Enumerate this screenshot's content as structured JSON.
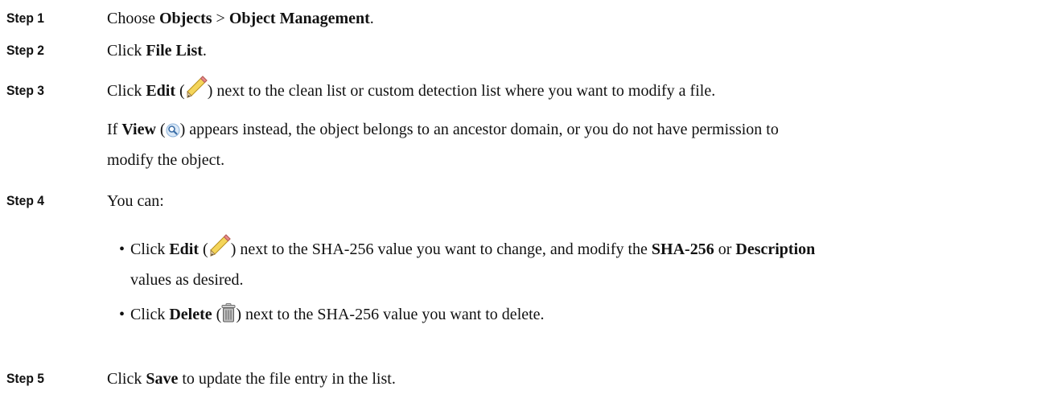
{
  "steps": [
    {
      "label": "Step 1",
      "prefix": "Choose ",
      "b1": "Objects",
      "sep": " > ",
      "b2": "Object Management",
      "suffix": "."
    },
    {
      "label": "Step 2",
      "prefix": "Click ",
      "b1": "File List",
      "suffix": "."
    },
    {
      "label": "Step 3",
      "prefix": "Click ",
      "b1": "Edit",
      "open": " (",
      "close": ") next to the clean list or custom detection list where you want to modify a file.",
      "icon": "pencil-icon",
      "note_prefix": "If ",
      "note_b1": "View",
      "note_open": " (",
      "note_icon": "magnifier-icon",
      "note_line1": ") appears instead, the object belongs to an ancestor domain, or you do not have permission to",
      "note_line2": "modify the object."
    },
    {
      "label": "Step 4",
      "text": "You can:",
      "bullets": [
        {
          "prefix": "Click ",
          "b1": "Edit",
          "open": " (",
          "icon": "pencil-icon",
          "mid": ") next to the SHA-256 value you want to change, and modify the ",
          "b2": "SHA-256",
          "or": " or ",
          "b3": "Description",
          "line2": "values as desired."
        },
        {
          "prefix": "Click ",
          "b1": "Delete",
          "open": " (",
          "icon": "trash-icon",
          "suffix": ") next to the SHA-256 value you want to delete."
        }
      ]
    },
    {
      "label": "Step 5",
      "prefix": "Click ",
      "b1": "Save",
      "suffix": " to update the file entry in the list."
    }
  ]
}
